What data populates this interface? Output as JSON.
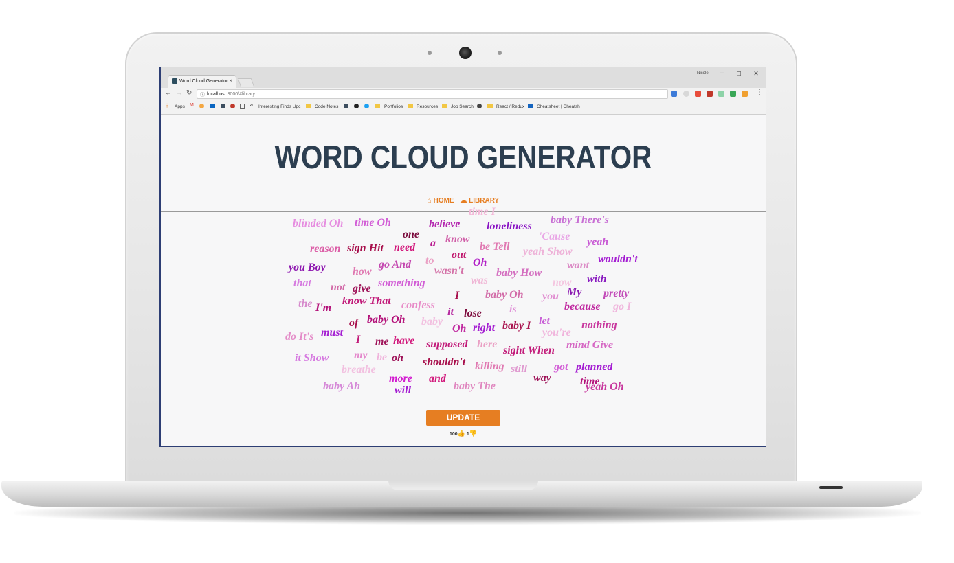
{
  "browser": {
    "user": "Nicole",
    "tab_title": "Word Cloud Generator",
    "tab_close": "×",
    "url_host": "localhost:",
    "url_path": "3000/#library",
    "window_controls": [
      "–",
      "☐",
      "✕"
    ],
    "bookmarks": {
      "apps": "Apps",
      "interesting": "Interesting Finds Upc",
      "code_notes": "Code Notes",
      "portfolios": "Portfolios",
      "resources": "Resources",
      "job_search": "Job Search",
      "react_redux": "React / Redux",
      "cheatsheet": "Cheatsheet | Cheatsh"
    }
  },
  "app": {
    "title": "WORD CLOUD GENERATOR",
    "nav": {
      "home": "HOME",
      "library": "LIBRARY"
    },
    "update_label": "UPDATE",
    "votes": {
      "up": "100",
      "down": "1"
    }
  },
  "words": [
    {
      "t": "time I",
      "c": "#f3b8d8",
      "s": 16
    },
    {
      "t": "blinded Oh",
      "c": "#e68de0",
      "s": 16
    },
    {
      "t": "time Oh",
      "c": "#d25ed6",
      "s": 16
    },
    {
      "t": "believe",
      "c": "#b42ab0",
      "s": 16
    },
    {
      "t": "loneliness",
      "c": "#8a14c4",
      "s": 16
    },
    {
      "t": "baby There's",
      "c": "#c86fd4",
      "s": 16
    },
    {
      "t": "one",
      "c": "#7a0a3c",
      "s": 16
    },
    {
      "t": "'Cause",
      "c": "#e9a6e6",
      "s": 16
    },
    {
      "t": "know",
      "c": "#d05fa8",
      "s": 16
    },
    {
      "t": "a",
      "c": "#b8178e",
      "s": 16
    },
    {
      "t": "reason",
      "c": "#dc5ea7",
      "s": 16
    },
    {
      "t": "sign Hit",
      "c": "#a8104c",
      "s": 16
    },
    {
      "t": "need",
      "c": "#d2197c",
      "s": 16
    },
    {
      "t": "be Tell",
      "c": "#e07ab2",
      "s": 16
    },
    {
      "t": "yeah",
      "c": "#c85ad4",
      "s": 16
    },
    {
      "t": "yeah Show",
      "c": "#eeb2d8",
      "s": 16
    },
    {
      "t": "out",
      "c": "#c0186e",
      "s": 16
    },
    {
      "t": "to",
      "c": "#eaa0c4",
      "s": 16
    },
    {
      "t": "wouldn't",
      "c": "#a41ed2",
      "s": 16
    },
    {
      "t": "you Boy",
      "c": "#8e18b0",
      "s": 16
    },
    {
      "t": "go And",
      "c": "#c448b0",
      "s": 16
    },
    {
      "t": "Oh",
      "c": "#b11fc6",
      "s": 16
    },
    {
      "t": "want",
      "c": "#dc8cc6",
      "s": 16
    },
    {
      "t": "how",
      "c": "#e07ab2",
      "s": 16
    },
    {
      "t": "wasn't",
      "c": "#d472a8",
      "s": 16
    },
    {
      "t": "baby How",
      "c": "#d46fc0",
      "s": 16
    },
    {
      "t": "that",
      "c": "#d67ae0",
      "s": 16
    },
    {
      "t": "was",
      "c": "#f0b7d6",
      "s": 16
    },
    {
      "t": "with",
      "c": "#8a1cc0",
      "s": 16
    },
    {
      "t": "something",
      "c": "#d25ed6",
      "s": 16
    },
    {
      "t": "now",
      "c": "#f4c6e0",
      "s": 16
    },
    {
      "t": "not",
      "c": "#d26aa8",
      "s": 16
    },
    {
      "t": "give",
      "c": "#9e1258",
      "s": 16
    },
    {
      "t": "My",
      "c": "#8a18b0",
      "s": 16
    },
    {
      "t": "pretty",
      "c": "#c24ab8",
      "s": 16
    },
    {
      "t": "baby Oh",
      "c": "#d26ca8",
      "s": 16
    },
    {
      "t": "I",
      "c": "#a8104c",
      "s": 16
    },
    {
      "t": "you",
      "c": "#e08cd0",
      "s": 16
    },
    {
      "t": "know That",
      "c": "#c21c7a",
      "s": 16
    },
    {
      "t": "the",
      "c": "#d68acc",
      "s": 16
    },
    {
      "t": "confess",
      "c": "#e88cc8",
      "s": 16
    },
    {
      "t": "because",
      "c": "#c028a0",
      "s": 16
    },
    {
      "t": "go I",
      "c": "#f0b4dc",
      "s": 16
    },
    {
      "t": "I'm",
      "c": "#b4127a",
      "s": 16
    },
    {
      "t": "is",
      "c": "#e094d8",
      "s": 16
    },
    {
      "t": "it",
      "c": "#b62aa0",
      "s": 16
    },
    {
      "t": "lose",
      "c": "#7c0a3c",
      "s": 16
    },
    {
      "t": "let",
      "c": "#c860d6",
      "s": 16
    },
    {
      "t": "of",
      "c": "#a8104c",
      "s": 16
    },
    {
      "t": "baby Oh",
      "c": "#b4127a",
      "s": 16
    },
    {
      "t": "baby",
      "c": "#f2c0e0",
      "s": 16
    },
    {
      "t": "baby I",
      "c": "#a8104c",
      "s": 16
    },
    {
      "t": "nothing",
      "c": "#c8389e",
      "s": 16
    },
    {
      "t": "Oh",
      "c": "#c028a0",
      "s": 16
    },
    {
      "t": "right",
      "c": "#a41ed2",
      "s": 16
    },
    {
      "t": "must",
      "c": "#a41ed2",
      "s": 16
    },
    {
      "t": "you're",
      "c": "#f0b4dc",
      "s": 16
    },
    {
      "t": "do It's",
      "c": "#e48cc8",
      "s": 16
    },
    {
      "t": "I",
      "c": "#c21c7a",
      "s": 16
    },
    {
      "t": "me",
      "c": "#9e1258",
      "s": 16
    },
    {
      "t": "have",
      "c": "#d2197c",
      "s": 16
    },
    {
      "t": "supposed",
      "c": "#c21c7a",
      "s": 16
    },
    {
      "t": "here",
      "c": "#eaa0c4",
      "s": 16
    },
    {
      "t": "mind Give",
      "c": "#d668c4",
      "s": 16
    },
    {
      "t": "sight When",
      "c": "#c21c7a",
      "s": 16
    },
    {
      "t": "my",
      "c": "#e488cc",
      "s": 16
    },
    {
      "t": "it Show",
      "c": "#d67ae0",
      "s": 16
    },
    {
      "t": "be",
      "c": "#f0b4dc",
      "s": 16
    },
    {
      "t": "oh",
      "c": "#9e1258",
      "s": 16
    },
    {
      "t": "shouldn't",
      "c": "#a8104c",
      "s": 16
    },
    {
      "t": "killing",
      "c": "#e07ab2",
      "s": 16
    },
    {
      "t": "still",
      "c": "#e09ad0",
      "s": 16
    },
    {
      "t": "got",
      "c": "#d25ed6",
      "s": 16
    },
    {
      "t": "planned",
      "c": "#a41ed2",
      "s": 16
    },
    {
      "t": "breathe",
      "c": "#f2c0e0",
      "s": 16
    },
    {
      "t": "more",
      "c": "#d21ad0",
      "s": 16
    },
    {
      "t": "and",
      "c": "#d2197c",
      "s": 16
    },
    {
      "t": "way",
      "c": "#9e1258",
      "s": 16
    },
    {
      "t": "time",
      "c": "#b4127a",
      "s": 16
    },
    {
      "t": "baby Ah",
      "c": "#d68ad8",
      "s": 16
    },
    {
      "t": "will",
      "c": "#a41ed2",
      "s": 16
    },
    {
      "t": "baby The",
      "c": "#e088c0",
      "s": 16
    },
    {
      "t": "yeah Oh",
      "c": "#c8389e",
      "s": 16
    }
  ]
}
